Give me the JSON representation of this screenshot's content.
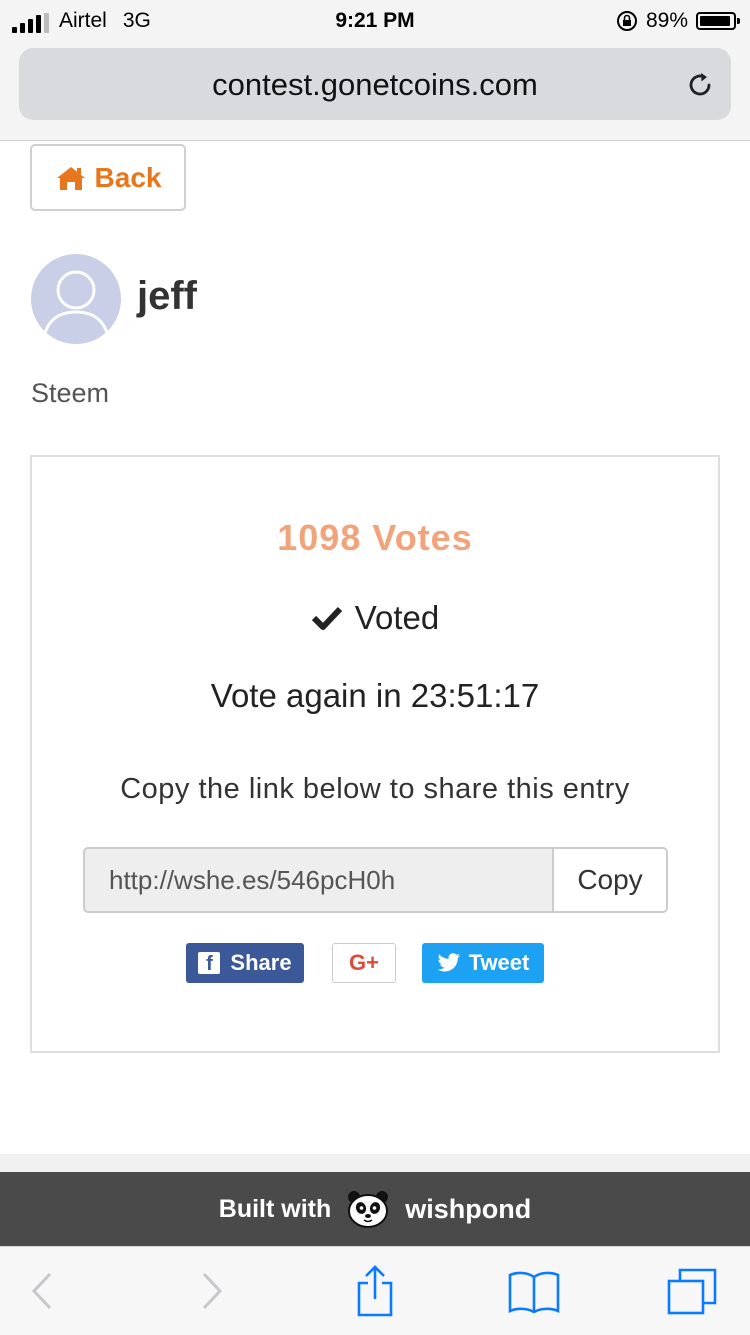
{
  "status_bar": {
    "carrier": "Airtel",
    "network": "3G",
    "time": "9:21 PM",
    "battery": "89%"
  },
  "browser": {
    "url": "contest.gonetcoins.com"
  },
  "nav": {
    "back_label": "Back"
  },
  "entry": {
    "username": "jeff",
    "title": "Steem"
  },
  "vote_card": {
    "votes_text": "1098 Votes",
    "voted_text": "Voted",
    "vote_again_text": "Vote again in 23:51:17",
    "share_hint": "Copy the link below to share this entry",
    "share_link": "http://wshe.es/546pcH0h",
    "copy_label": "Copy",
    "facebook_label": "Share",
    "google_label": "G+",
    "twitter_label": "Tweet"
  },
  "footer": {
    "built_with": "Built with",
    "brand": "wishpond"
  },
  "colors": {
    "accent_orange": "#e8761c",
    "votes_color": "#f2a37b",
    "facebook": "#3b5998",
    "twitter": "#1da1f2",
    "google": "#dd4b39",
    "footer_bg": "#4a4a4a"
  },
  "icons": {
    "back": "home-icon",
    "voted": "checkmark-icon",
    "reload": "reload-icon",
    "toolbar": [
      "back-arrow-icon",
      "forward-arrow-icon",
      "share-icon",
      "bookmarks-icon",
      "tabs-icon"
    ]
  }
}
